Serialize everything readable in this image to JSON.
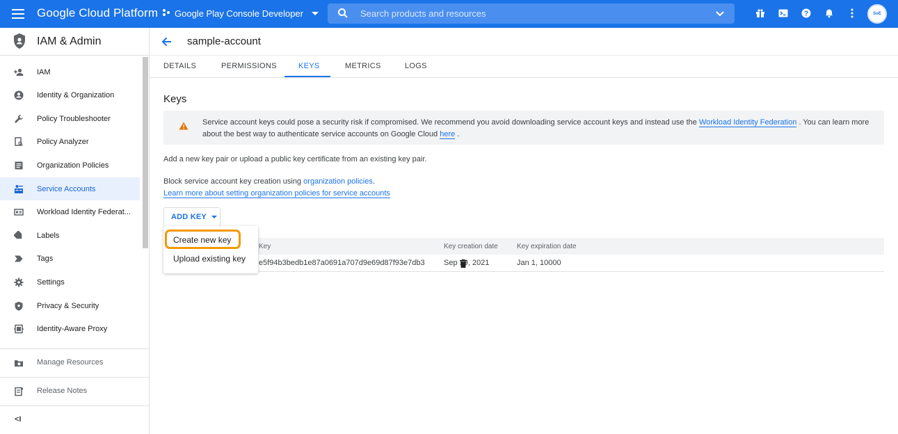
{
  "topbar": {
    "brand": "Google Cloud Platform",
    "project": "Google Play Console Developer",
    "search_placeholder": "Search products and resources",
    "icons": [
      "gift-icon",
      "terminal-icon",
      "help-icon",
      "bell-icon",
      "more-vert-icon"
    ],
    "avatar_text": "SoE"
  },
  "sidebar": {
    "title": "IAM & Admin",
    "items": [
      {
        "label": "IAM",
        "icon": "person-add-icon",
        "active": false
      },
      {
        "label": "Identity & Organization",
        "icon": "account-circle-icon",
        "active": false
      },
      {
        "label": "Policy Troubleshooter",
        "icon": "wrench-icon",
        "active": false
      },
      {
        "label": "Policy Analyzer",
        "icon": "document-search-icon",
        "active": false
      },
      {
        "label": "Organization Policies",
        "icon": "list-icon",
        "active": false
      },
      {
        "label": "Service Accounts",
        "icon": "service-account-icon",
        "active": true
      },
      {
        "label": "Workload Identity Federat...",
        "icon": "id-card-icon",
        "active": false
      },
      {
        "label": "Labels",
        "icon": "label-icon",
        "active": false
      },
      {
        "label": "Tags",
        "icon": "tag-icon",
        "active": false
      },
      {
        "label": "Settings",
        "icon": "gear-icon",
        "active": false
      },
      {
        "label": "Privacy & Security",
        "icon": "shield-icon",
        "active": false
      },
      {
        "label": "Identity-Aware Proxy",
        "icon": "proxy-icon",
        "active": false
      }
    ],
    "footer": [
      {
        "label": "Manage Resources",
        "icon": "folder-settings-icon"
      },
      {
        "label": "Release Notes",
        "icon": "notes-icon"
      }
    ],
    "collapse_glyph": "<I"
  },
  "page": {
    "account_name": "sample-account",
    "tabs": [
      "DETAILS",
      "PERMISSIONS",
      "KEYS",
      "METRICS",
      "LOGS"
    ],
    "active_tab": "KEYS",
    "heading": "Keys",
    "warning": {
      "text_before": "Service account keys could pose a security risk if compromised. We recommend you avoid downloading service account keys and instead use the",
      "link1": "Workload Identity Federation",
      "text_middle": ". You can learn more about the best way to authenticate service accounts on Google Cloud",
      "link2": "here",
      "text_after": "."
    },
    "add_key_help": "Add a new key pair or upload a public key certificate from an existing key pair.",
    "block_text": "Block service account key creation using",
    "block_link": "organization policies",
    "block_period": ".",
    "learn_more": "Learn more about setting organization policies for service accounts",
    "add_key_button": "ADD KEY",
    "menu": [
      "Create new key",
      "Upload existing key"
    ],
    "table": {
      "headers": [
        "Key",
        "Key creation date",
        "Key expiration date"
      ],
      "rows": [
        {
          "key": "e5f94b3bedb1e87a0691a707d9e69d87f93e7db3",
          "created": "Sep 19, 2021",
          "expires": "Jan 1, 10000"
        }
      ]
    }
  },
  "colors": {
    "accent": "#1a73e8",
    "highlight": "#f29900",
    "warning": "#e37400"
  }
}
